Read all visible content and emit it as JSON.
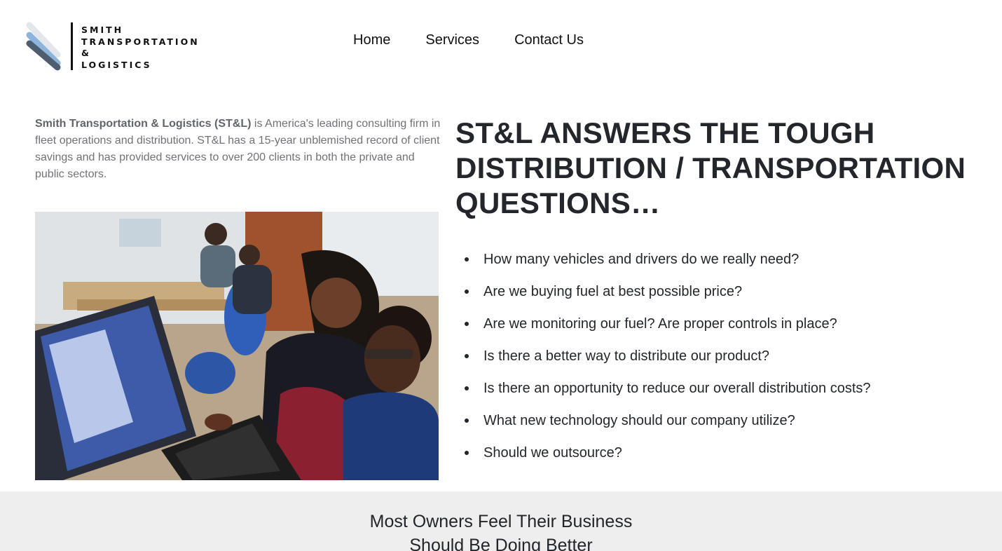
{
  "header": {
    "logo": {
      "lines": [
        "SMITH",
        "TRANSPORTATION",
        "&",
        "LOGISTICS"
      ],
      "mark_colors": [
        "#e3e6ea",
        "#8cb4dd",
        "#4e5e6e"
      ]
    },
    "nav": [
      {
        "label": "Home"
      },
      {
        "label": "Services"
      },
      {
        "label": "Contact Us"
      }
    ]
  },
  "intro": {
    "company_name": "Smith Transportation & Logistics (ST&L)",
    "text": " is America's leading consulting firm in fleet operations and distribution. ST&L has a 15-year unblemished record of client savings and has provided services to over 200 clients in both the private and public sectors."
  },
  "photo": {
    "subject": "two-people-working-at-laptop-photo"
  },
  "main": {
    "headline": "ST&L ANSWERS THE TOUGH DISTRIBUTION / TRANSPORTATION QUESTIONS…",
    "questions": [
      "How many vehicles and drivers do we really need?",
      "Are we buying fuel at best possible price?",
      "Are we monitoring our fuel? Are proper controls in place?",
      "Is there a better way to distribute our product?",
      "Is there an opportunity to reduce our overall distribution costs?",
      "What new technology should our company utilize?",
      "Should we outsource?"
    ]
  },
  "band": {
    "line1": "Most Owners Feel Their Business",
    "line2": "Should Be Doing Better"
  }
}
